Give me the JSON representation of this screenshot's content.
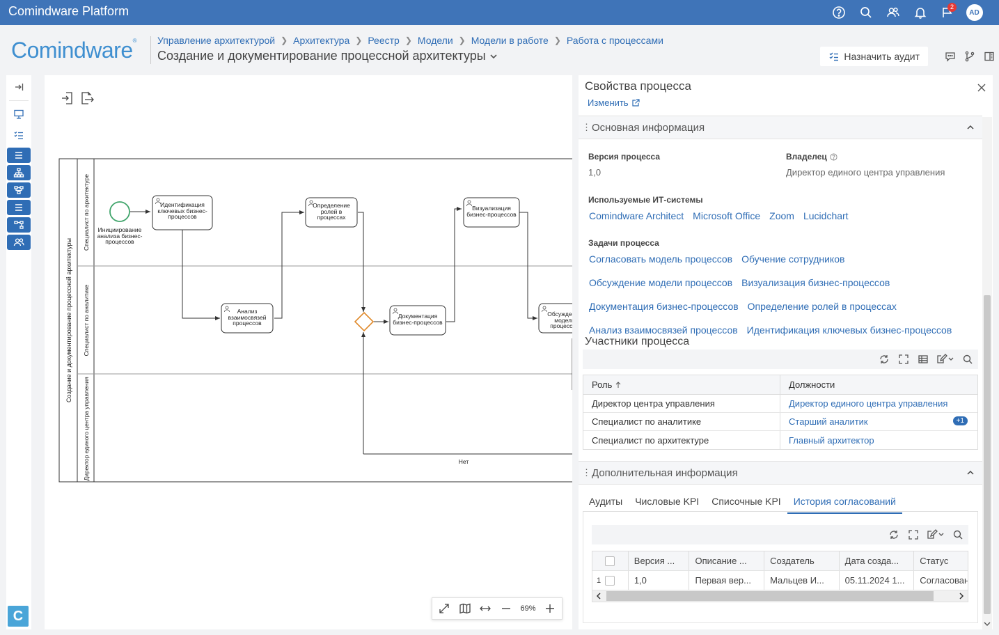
{
  "app": {
    "title": "Comindware Platform",
    "logo": "Comindware",
    "messages_badge": "2",
    "avatar": "AD"
  },
  "breadcrumbs": [
    "Управление архитектурой",
    "Архитектура",
    "Реестр",
    "Модели",
    "Модели в работе",
    "Работа с процессами"
  ],
  "page": {
    "title": "Создание и документирование процессной архитектуры",
    "audit_button": "Назначить аудит"
  },
  "diagram": {
    "pool_label": "Создание и документирование процессной архитектуры",
    "lanes": [
      "Специалист по архитектуре",
      "Специалист по аналитике",
      "Директор единого центра управления"
    ],
    "start_label": "Инициирование анализа бизнес-процессов",
    "tasks": {
      "t1": "Идентификация ключевых бизнес-процессов",
      "t2": "Анализ взаимосвязей процессов",
      "t3": "Определение ролей в процессах",
      "t4": "Документация бизнес-процессов",
      "t5": "Визуализация бизнес-процессов",
      "t6": "Обсуждение модели процессов"
    },
    "flow_label": "Нет",
    "zoom": "69%"
  },
  "panel": {
    "title": "Свойства процесса",
    "edit_link": "Изменить",
    "main_section": "Основная информация",
    "version_label": "Версия процесса",
    "version_value": "1,0",
    "owner_label": "Владелец",
    "owner_value": "Директор единого центра управления",
    "it_label": "Используемые ИТ-системы",
    "it_systems": [
      "Comindware Architect",
      "Microsoft Office",
      "Zoom",
      "Lucidchart"
    ],
    "tasks_label": "Задачи процесса",
    "tasks": [
      [
        "Согласовать модель процессов",
        "Обучение сотрудников"
      ],
      [
        "Обсуждение модели процессов",
        "Визуализация бизнес-процессов"
      ],
      [
        "Документация бизнес-процессов",
        "Определение ролей в процессах"
      ],
      [
        "Анализ взаимосвязей процессов",
        "Идентификация ключевых бизнес-процессов"
      ]
    ],
    "participants_label": "Участники процесса",
    "participants_cols": [
      "Роль",
      "Должности"
    ],
    "participants": [
      {
        "role": "Директор центра управления",
        "position": "Директор единого центра управления",
        "extra": ""
      },
      {
        "role": "Специалист по аналитике",
        "position": "Старший аналитик",
        "extra": "+1"
      },
      {
        "role": "Специалист по архитектуре",
        "position": "Главный архитектор",
        "extra": ""
      }
    ],
    "extra_section": "Дополнительная информация",
    "tabs": [
      "Аудиты",
      "Числовые KPI",
      "Списочные KPI",
      "История согласований"
    ],
    "active_tab": 3,
    "history_cols": [
      "Версия ...",
      "Описание ...",
      "Создатель",
      "Дата созда...",
      "Статус"
    ],
    "history_rows": [
      {
        "n": "1",
        "version": "1,0",
        "desc": "Первая вер...",
        "creator": "Мальцев И...",
        "date": "05.11.2024 1...",
        "status": "Согласован"
      }
    ]
  }
}
